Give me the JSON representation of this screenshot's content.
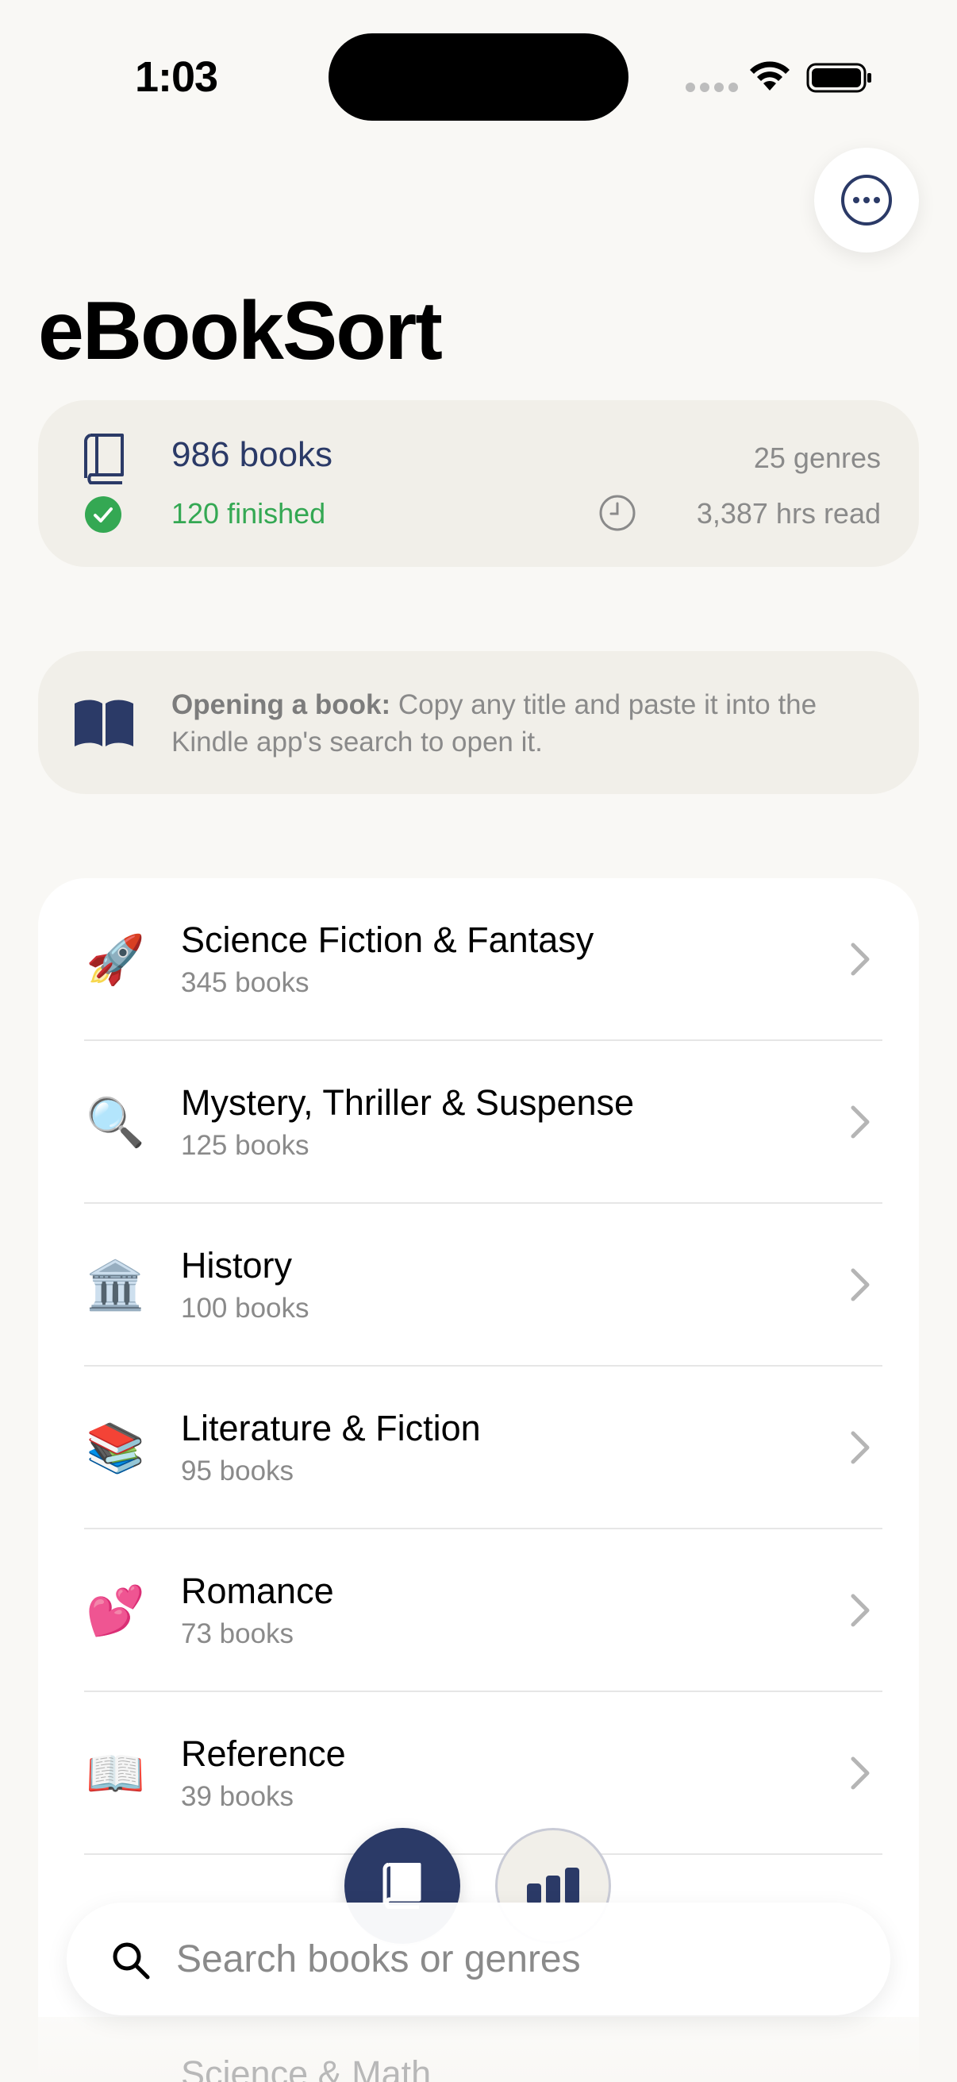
{
  "status_bar": {
    "time": "1:03"
  },
  "header": {
    "title": "eBookSort"
  },
  "stats": {
    "books": "986 books",
    "finished": "120 finished",
    "genres": "25 genres",
    "hours": "3,387 hrs read"
  },
  "tip": {
    "bold": "Opening a book:",
    "text": " Copy any title and paste it into the Kindle app's search to open it."
  },
  "genres": [
    {
      "emoji": "🚀",
      "name": "Science Fiction & Fantasy",
      "count": "345 books"
    },
    {
      "emoji": "🔍",
      "name": "Mystery, Thriller & Suspense",
      "count": "125 books"
    },
    {
      "emoji": "🏛️",
      "name": "History",
      "count": "100 books"
    },
    {
      "emoji": "📚",
      "name": "Literature & Fiction",
      "count": "95 books"
    },
    {
      "emoji": "💕",
      "name": "Romance",
      "count": "73 books"
    },
    {
      "emoji": "📖",
      "name": "Reference",
      "count": "39 books"
    }
  ],
  "below_search": {
    "label": "Science & Math"
  },
  "search": {
    "placeholder": "Search books or genres"
  },
  "colors": {
    "accent": "#2b3a67",
    "success": "#34a853",
    "background": "#f9f8f5",
    "card": "#f1efe9"
  }
}
